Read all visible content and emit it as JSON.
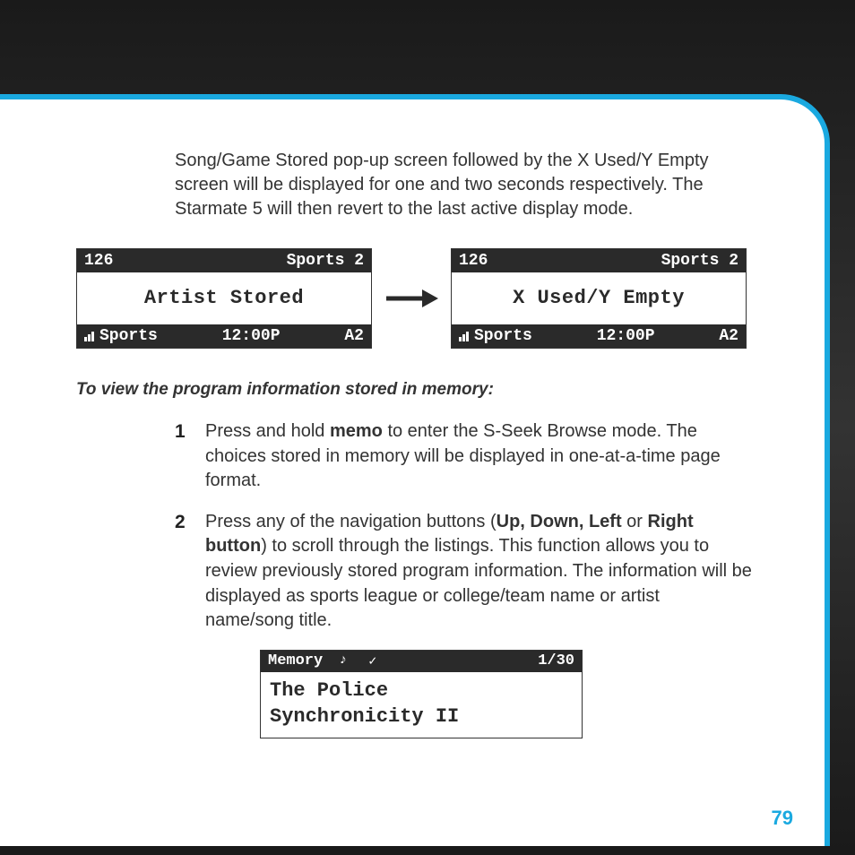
{
  "intro": "Song/Game Stored pop-up screen followed by the X Used/Y Empty screen will be displayed for one and two seconds respectively. The Starmate 5 will then revert to the last active display mode.",
  "screen1": {
    "channel": "126",
    "channel_name": "Sports 2",
    "body": "Artist Stored",
    "category": "Sports",
    "time": "12:00P",
    "preset": "A2"
  },
  "screen2": {
    "channel": "126",
    "channel_name": "Sports 2",
    "body": "X Used/Y Empty",
    "category": "Sports",
    "time": "12:00P",
    "preset": "A2"
  },
  "subhead": "To view the program information stored in memory:",
  "steps": {
    "1": {
      "num": "1",
      "pre": "Press and hold ",
      "bold1": "memo",
      "post": " to enter the S-Seek Browse mode. The choices stored in memory will be displayed in one-at-a-time page format."
    },
    "2": {
      "num": "2",
      "pre": "Press any of the navigation buttons (",
      "bold1": "Up, Down, Left",
      "mid": " or ",
      "bold2": "Right button",
      "post": ") to scroll through the listings. This function allows you to review previously stored program information. The information will be displayed as sports league or college/team name or artist name/song title."
    }
  },
  "memory": {
    "label": "Memory",
    "note_icon": "♪",
    "check_icon": "✓",
    "count": "1/30",
    "line1": "The Police",
    "line2": "Synchronicity II"
  },
  "page_number": "79"
}
